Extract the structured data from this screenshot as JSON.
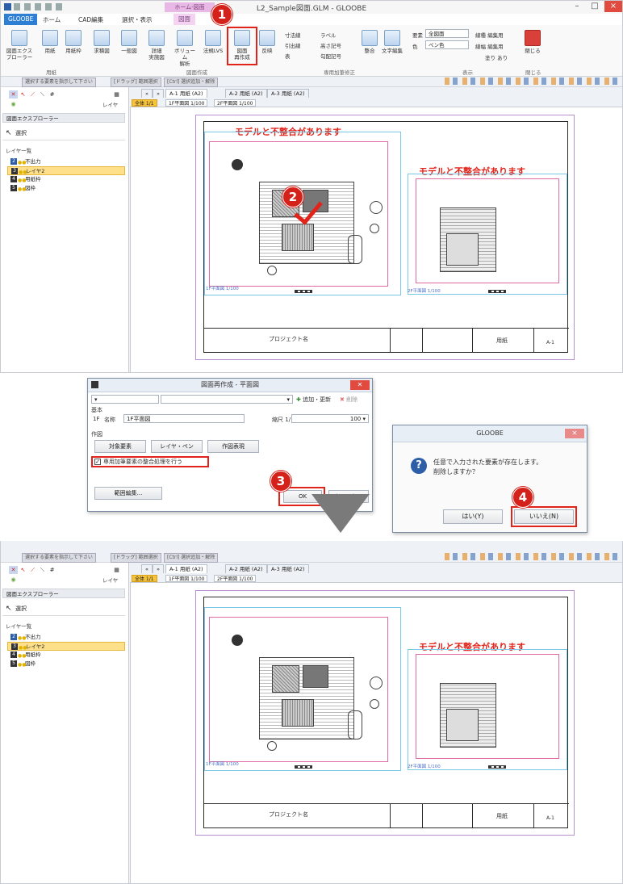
{
  "window": {
    "title": "L2_Sample図面.GLM - GLOOBE",
    "context_tab_group": "ホーム-図面",
    "minimize": "–",
    "maximize": "□",
    "close": "×"
  },
  "menu": {
    "app": "GLOOBE",
    "tabs": [
      "ホーム",
      "CAD編集",
      "選択・表示"
    ],
    "context_tab": "図面"
  },
  "ribbon": {
    "explorer": "図面エクス\nプローラー",
    "paper": "用紙",
    "paper_frame": "用紙枠",
    "group_paper": "用紙",
    "elev": "求積図",
    "general": "一般図",
    "detail": "詳細\n実施図",
    "volume": "ボリューム\n解析",
    "law": "法規LVS",
    "regen": "図面\n再作成",
    "group_create": "図面作成",
    "reflect": "反映",
    "dim": "寸法線",
    "leader": "引出線",
    "table": "表",
    "label": "ラベル",
    "height": "高さ記号",
    "slope": "勾配記号",
    "align": "整合",
    "textedit": "文字編集",
    "group_fix": "専用加筆修正",
    "elem_label": "要素",
    "elem_value": "全図面",
    "color_label": "色",
    "color_value": "ペン色",
    "line_type": "線種 編集用",
    "line_width": "線幅 編集用",
    "fill": "塗り あり",
    "group_display": "表示",
    "close": "閉じる",
    "group_close": "閉じる"
  },
  "status_hints": [
    "選択する要素を指示して下さい",
    "[ドラッグ] 範囲選択",
    "[Ctrl] 選択追加・解除"
  ],
  "left_panel": {
    "layer_button": "レイヤ",
    "explorer_header": "図面エクスプローラー",
    "select_label": "選択",
    "layer_list_label": "レイヤ一覧",
    "layers": [
      {
        "num": "2",
        "name": "不出力"
      },
      {
        "num": "3",
        "name": "レイヤ2"
      },
      {
        "num": "4",
        "name": "用紙枠"
      },
      {
        "num": "5",
        "name": "図枠"
      }
    ]
  },
  "sheet_tabs": [
    "A-1 用紙 (A2)",
    "A-2 用紙 (A2)",
    "A-3 用紙 (A2)"
  ],
  "sheet_subtabs": [
    "全体 1/1",
    "1F平面図 1/100",
    "2F平面図 1/100"
  ],
  "drawing": {
    "warning": "モデルと不整合があります",
    "plan1_label": "1F平面図 1/100",
    "plan2_label": "2F平面図 1/100",
    "project_name": "プロジェクト名",
    "sheet_name": "用紙",
    "sheet_code": "A-1"
  },
  "dialog_regen": {
    "title": "図面再作成 - 平面図",
    "add_update": "追加・更新",
    "delete": "削除",
    "basic_label": "基本",
    "floor": "1F",
    "name_label": "名称",
    "name_value": "1F平面図",
    "scale_label": "縮尺 1/",
    "scale_value": "100",
    "draw_label": "作図",
    "target_btn": "対象要素",
    "layer_pen_btn": "レイヤ・ペン",
    "draw_expr_btn": "作図表現",
    "checkbox_label": "専用加筆要素の整合処理を行う",
    "range_btn": "範囲編集...",
    "ok": "OK",
    "cancel": "キャンセル"
  },
  "dialog_confirm": {
    "title": "GLOOBE",
    "message_line1": "任意で入力された要素が存在します。",
    "message_line2": "削除しますか？",
    "yes": "はい(Y)",
    "no": "いいえ(N)"
  },
  "steps": [
    "1",
    "2",
    "3",
    "4"
  ],
  "colors": {
    "accent_red": "#e2231a",
    "badge_red": "#d4221b",
    "tab_blue": "#2d7fd3",
    "highlight_yellow": "#f6c33a"
  }
}
